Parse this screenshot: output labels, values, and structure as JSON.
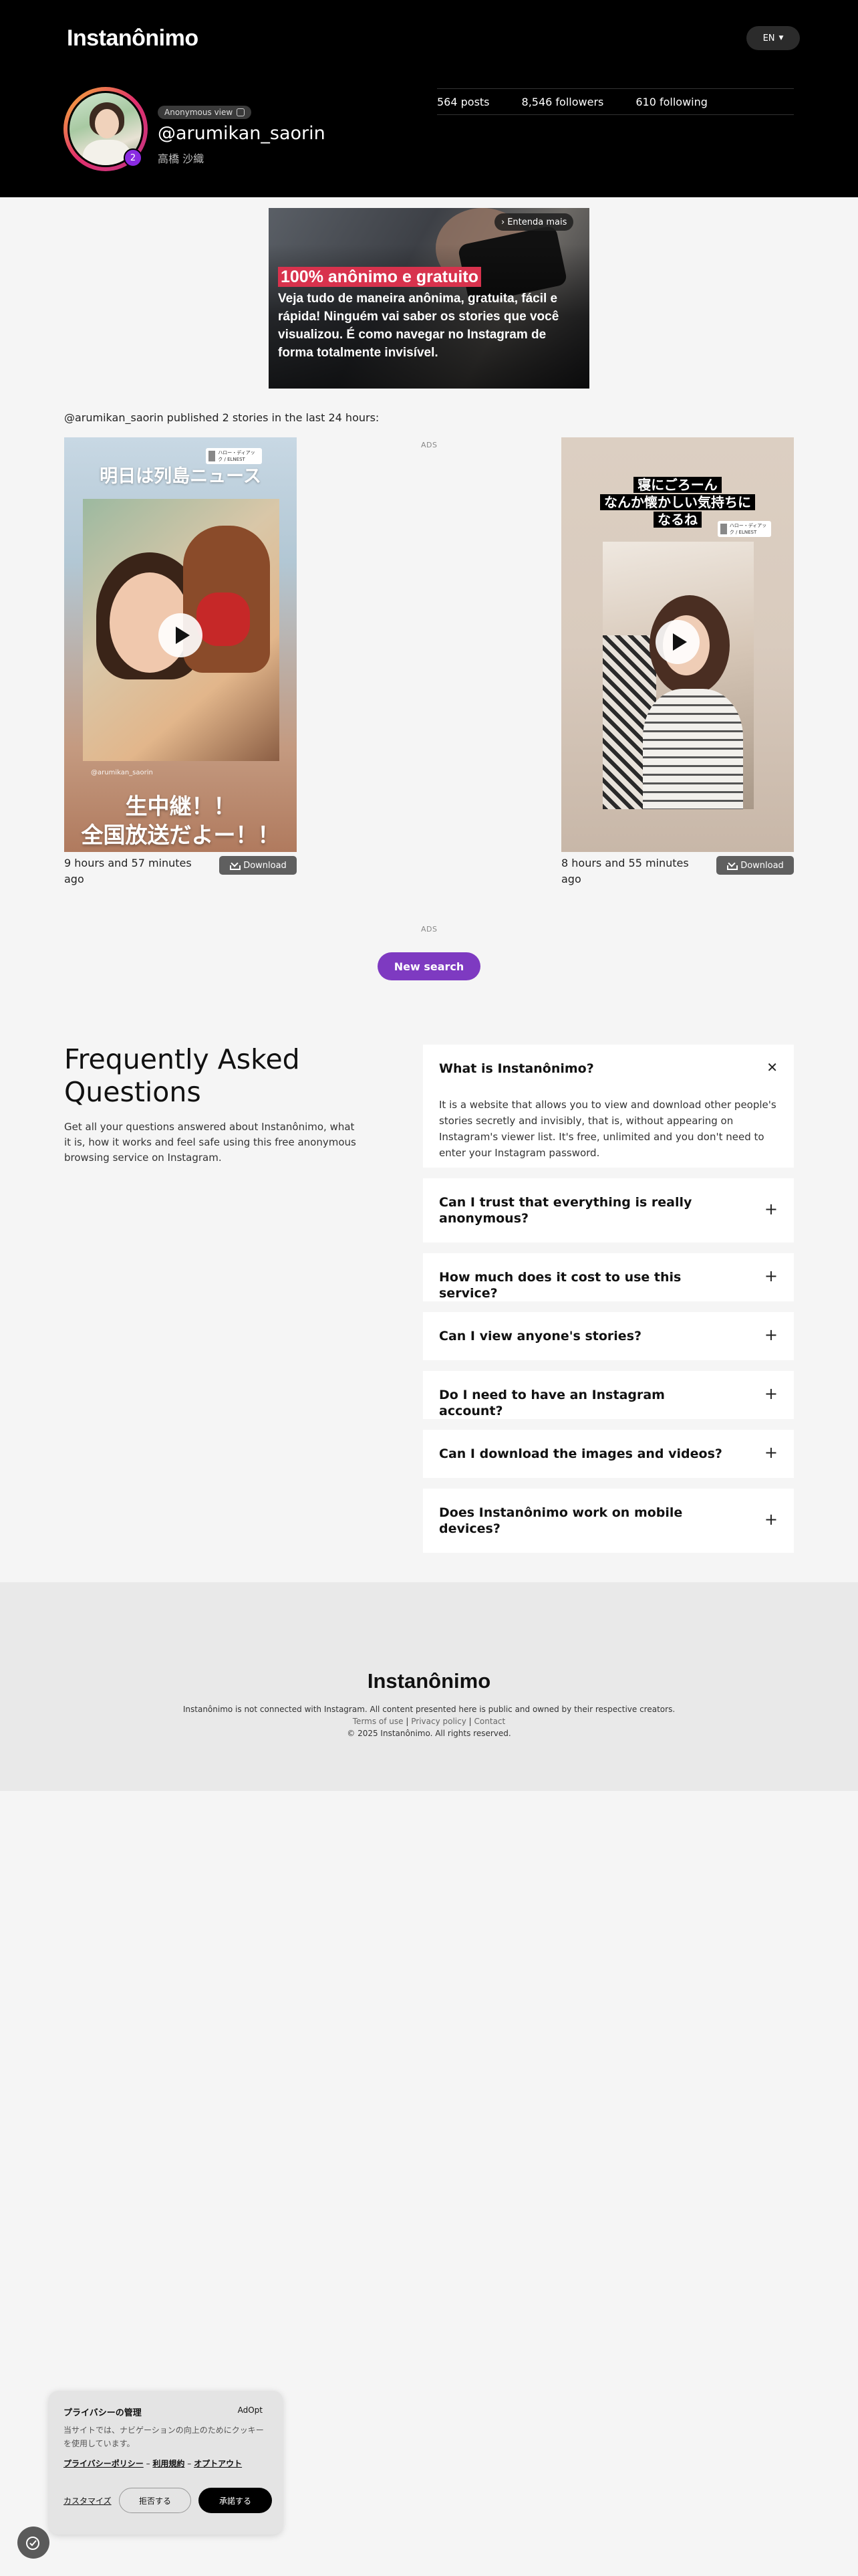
{
  "header": {
    "logo": "Instanônimo",
    "language": "EN",
    "profile": {
      "anonymous_badge": "Anonymous view",
      "username": "@arumikan_saorin",
      "real_name": "高橋 沙織",
      "story_count": "2"
    },
    "stats": {
      "posts": "564 posts",
      "followers": "8,546 followers",
      "following": "610 following"
    }
  },
  "ad_banner": {
    "cta": "Entenda mais",
    "headline": "100% anônimo e gratuito",
    "body": "Veja tudo de maneira anônima, gratuita, fácil e rápida! Ninguém vai saber os stories que você visualizou. É como navegar no Instagram de forma totalmente invisível."
  },
  "published_text": "@arumikan_saorin published 2 stories in the last 24 hours:",
  "ads_label": "ADS",
  "stories": [
    {
      "top_text": "明日は列島ニュース",
      "bottom_text_1": "生中継！！",
      "bottom_text_2": "全国放送だよー！！",
      "handle": "@arumikan_saorin",
      "tag_text": "ハロー・ディアック / ELNEST",
      "time": "9 hours and 57 minutes ago",
      "download_label": "Download"
    },
    {
      "title_1": "寝にごろーん",
      "title_2": "なんか懐かしい気持ちに",
      "title_3": "なるね",
      "tag_text": "ハロー・ディアック / ELNEST",
      "time": "8 hours and 55 minutes ago",
      "download_label": "Download"
    }
  ],
  "new_search_label": "New search",
  "faq": {
    "title": "Frequently Asked Questions",
    "subtitle": "Get all your questions answered about Instanônimo, what it is, how it works and feel safe using this free anonymous browsing service on Instagram.",
    "items": [
      {
        "question": "What is Instanônimo?",
        "answer": "It is a website that allows you to view and download other people's stories secretly and invisibly, that is, without appearing on Instagram's viewer list. It's free, unlimited and you don't need to enter your Instagram password.",
        "sign": "✕"
      },
      {
        "question": "Can I trust that everything is really anonymous?",
        "sign": "+"
      },
      {
        "question": "How much does it cost to use this service?",
        "sign": "+"
      },
      {
        "question": "Can I view anyone's stories?",
        "sign": "+"
      },
      {
        "question": "Do I need to have an Instagram account?",
        "sign": "+"
      },
      {
        "question": "Can I download the images and videos?",
        "sign": "+"
      },
      {
        "question": "Does Instanônimo work on mobile devices?",
        "sign": "+"
      }
    ]
  },
  "footer": {
    "logo": "Instanônimo",
    "disclaimer": "Instanônimo is not connected with Instagram. All content presented here is public and owned by their respective creators.",
    "terms": "Terms of use",
    "privacy": "Privacy policy",
    "contact": "Contact",
    "sep": "|",
    "copyright": "© 2025 Instanônimo. All rights reserved."
  },
  "cookie": {
    "title": "プライバシーの管理",
    "brand": "AdOpt",
    "body": "当サイトでは、ナビゲーションの向上のためにクッキーを使用しています。",
    "link_privacy": "プライバシーポリシー",
    "link_terms": "利用規約",
    "link_optout": "オプトアウト",
    "dash": "–",
    "customize": "カスタマイズ",
    "reject": "拒否する",
    "accept": "承諾する"
  },
  "colors": {
    "accent_purple": "#7e3ac1",
    "ad_headline_red": "#d8324d",
    "header_bg": "#000000"
  }
}
